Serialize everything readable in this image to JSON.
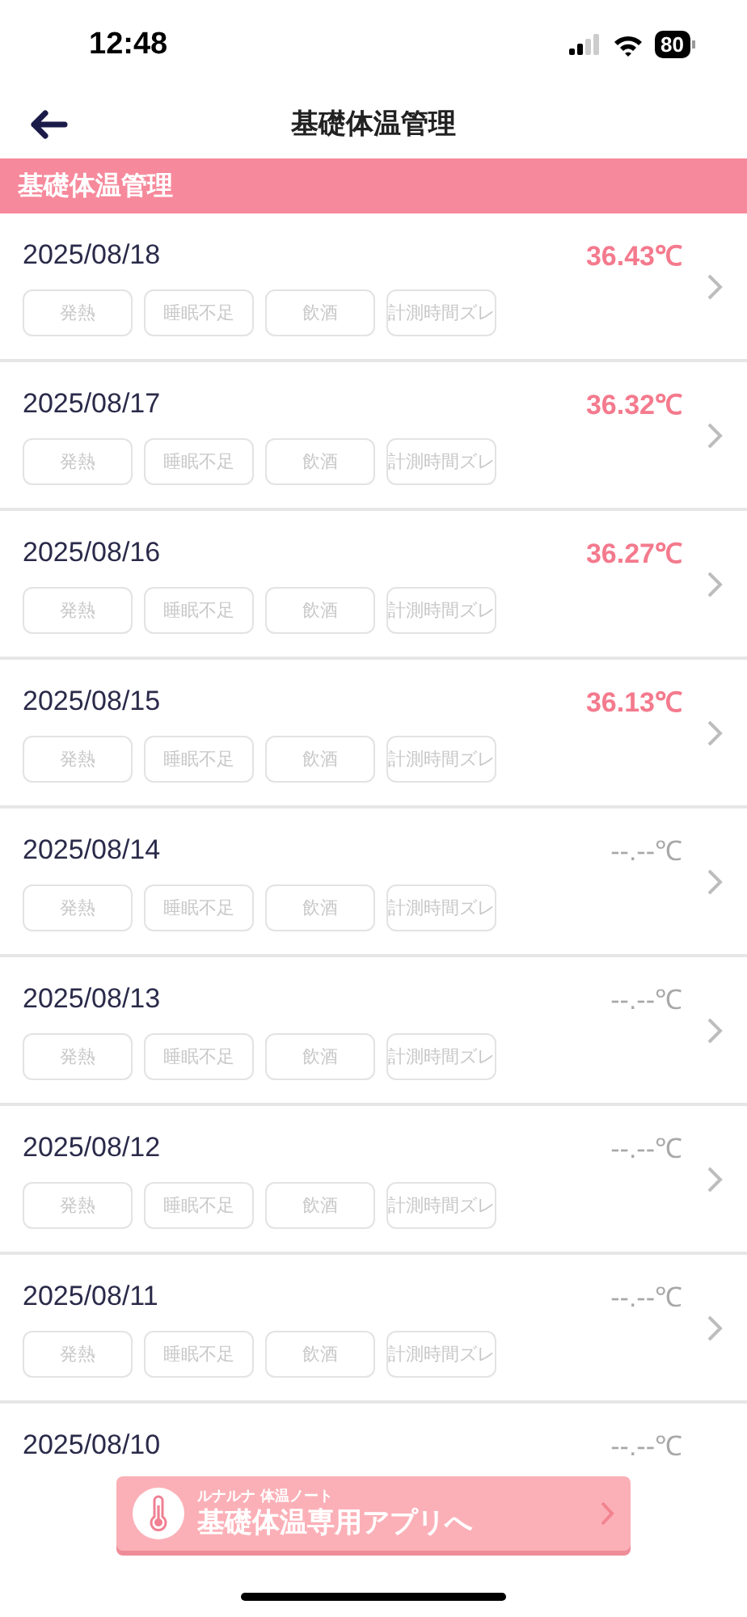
{
  "status_bar": {
    "time": "12:48",
    "battery": "80"
  },
  "nav": {
    "title": "基礎体温管理"
  },
  "section": {
    "title": "基礎体温管理"
  },
  "rows": [
    {
      "date": "2025/08/18",
      "temperature": "36.43℃",
      "measured": true,
      "tags": [
        "発熱",
        "睡眠不足",
        "飲酒",
        "計測時間ズレ"
      ]
    },
    {
      "date": "2025/08/17",
      "temperature": "36.32℃",
      "measured": true,
      "tags": [
        "発熱",
        "睡眠不足",
        "飲酒",
        "計測時間ズレ"
      ]
    },
    {
      "date": "2025/08/16",
      "temperature": "36.27℃",
      "measured": true,
      "tags": [
        "発熱",
        "睡眠不足",
        "飲酒",
        "計測時間ズレ"
      ]
    },
    {
      "date": "2025/08/15",
      "temperature": "36.13℃",
      "measured": true,
      "tags": [
        "発熱",
        "睡眠不足",
        "飲酒",
        "計測時間ズレ"
      ]
    },
    {
      "date": "2025/08/14",
      "temperature": "--.--℃",
      "measured": false,
      "tags": [
        "発熱",
        "睡眠不足",
        "飲酒",
        "計測時間ズレ"
      ]
    },
    {
      "date": "2025/08/13",
      "temperature": "--.--℃",
      "measured": false,
      "tags": [
        "発熱",
        "睡眠不足",
        "飲酒",
        "計測時間ズレ"
      ]
    },
    {
      "date": "2025/08/12",
      "temperature": "--.--℃",
      "measured": false,
      "tags": [
        "発熱",
        "睡眠不足",
        "飲酒",
        "計測時間ズレ"
      ]
    },
    {
      "date": "2025/08/11",
      "temperature": "--.--℃",
      "measured": false,
      "tags": [
        "発熱",
        "睡眠不足",
        "飲酒",
        "計測時間ズレ"
      ]
    },
    {
      "date": "2025/08/10",
      "temperature": "--.--℃",
      "measured": false
    }
  ],
  "app_banner": {
    "subtitle": "ルナルナ 体温ノート",
    "title": "基礎体温専用アプリへ"
  }
}
